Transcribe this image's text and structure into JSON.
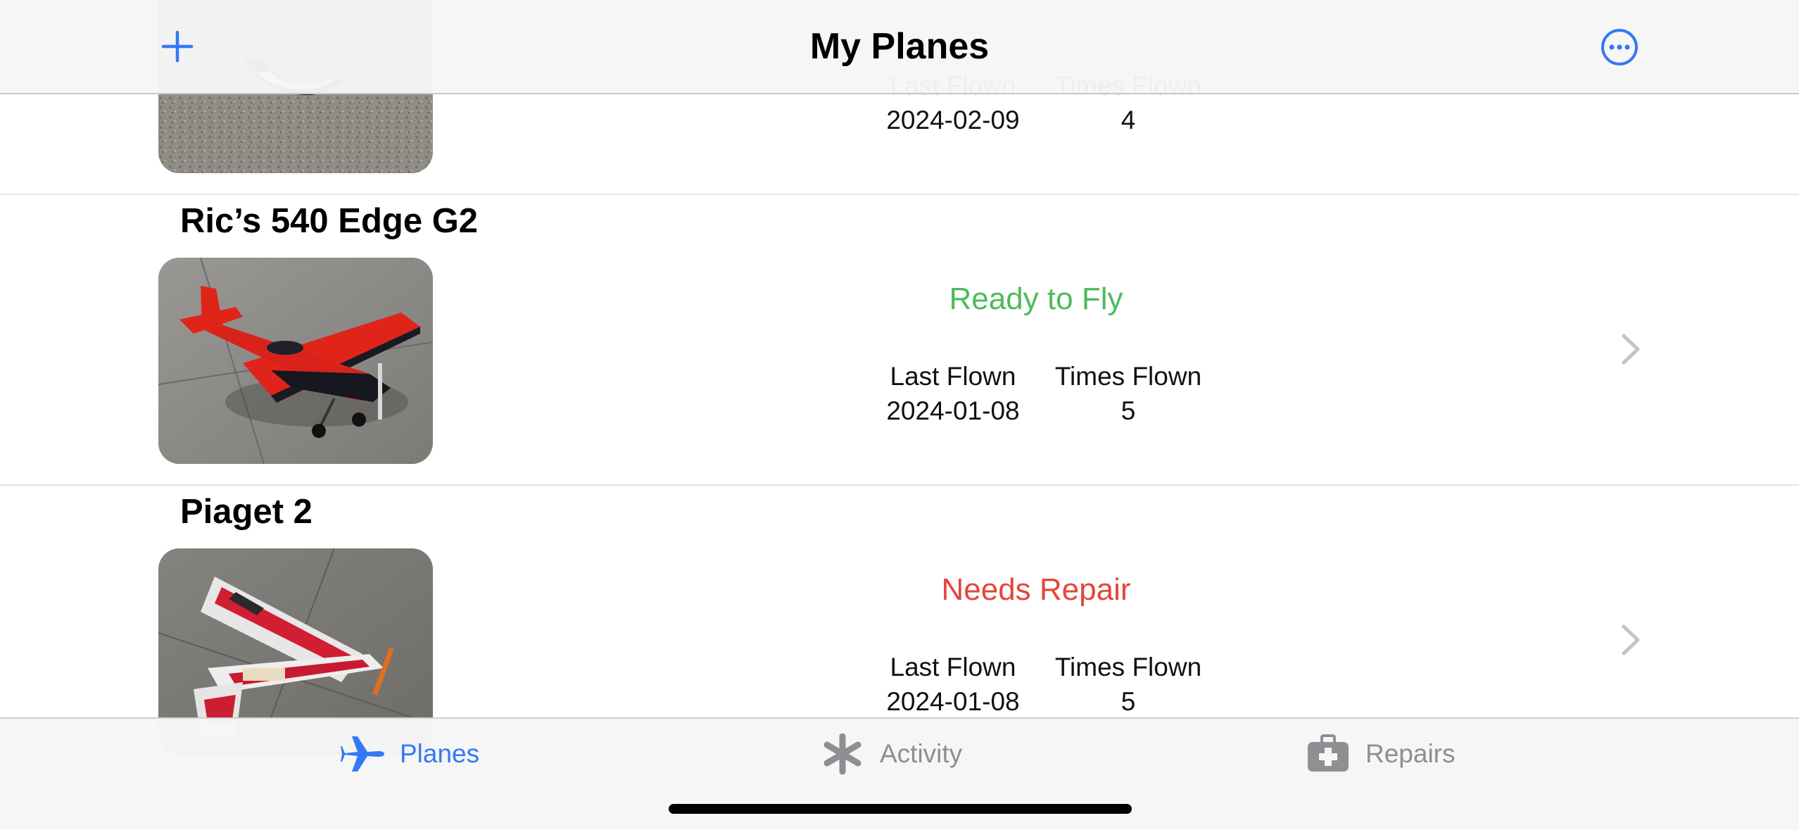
{
  "nav": {
    "title": "My Planes",
    "add_icon": "plus-icon",
    "more_icon": "ellipsis-circle-icon",
    "accent": "#3478f6"
  },
  "planes": [
    {
      "name": "",
      "status": "",
      "status_color": "#4cbb5a",
      "last_flown_label": "Last Flown",
      "last_flown": "2024-02-09",
      "times_flown_label": "Times Flown",
      "times_flown": "4"
    },
    {
      "name": "Ric’s 540 Edge G2",
      "status": "Ready to Fly",
      "status_color": "#4cbb5a",
      "last_flown_label": "Last Flown",
      "last_flown": "2024-01-08",
      "times_flown_label": "Times Flown",
      "times_flown": "5"
    },
    {
      "name": "Piaget 2",
      "status": "Needs Repair",
      "status_color": "#e4463a",
      "last_flown_label": "Last Flown",
      "last_flown": "2024-01-08",
      "times_flown_label": "Times Flown",
      "times_flown": "5"
    }
  ],
  "tabs": [
    {
      "label": "Planes",
      "icon": "airplane-icon",
      "selected": true,
      "color": "#3478f6"
    },
    {
      "label": "Activity",
      "icon": "asterisk-icon",
      "selected": false,
      "color": "#8e8e93"
    },
    {
      "label": "Repairs",
      "icon": "medical-kit-icon",
      "selected": false,
      "color": "#8e8e93"
    }
  ]
}
